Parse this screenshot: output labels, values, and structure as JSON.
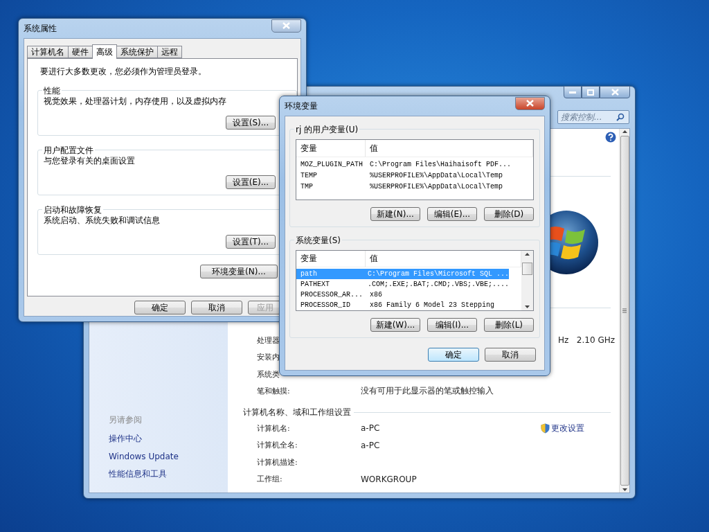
{
  "control_panel": {
    "search": {
      "placeholder": "搜索控制..."
    },
    "sidebar": {
      "heading": "另请参阅",
      "links": [
        "操作中心",
        "Windows Update",
        "性能信息和工具"
      ]
    },
    "system_rows": [
      {
        "label": "处理器",
        "value": "",
        "value_right": "Hz   2.10 GHz"
      },
      {
        "label": "安装内",
        "value": "",
        "value_right": ""
      },
      {
        "label": "系统类",
        "value": "",
        "value_right": ""
      },
      {
        "label": "笔和触摸:",
        "value": "没有可用于此显示器的笔或触控输入",
        "value_right": ""
      }
    ],
    "name_section": {
      "title": "计算机名称、域和工作组设置",
      "change_link": "更改设置",
      "rows": [
        {
          "label": "计算机名:",
          "value": "a-PC"
        },
        {
          "label": "计算机全名:",
          "value": "a-PC"
        },
        {
          "label": "计算机描述:",
          "value": ""
        },
        {
          "label": "工作组:",
          "value": "WORKGROUP"
        }
      ]
    }
  },
  "system_properties": {
    "title": "系统属性",
    "tabs": [
      {
        "label": "计算机名",
        "selected": false
      },
      {
        "label": "硬件",
        "selected": false
      },
      {
        "label": "高级",
        "selected": true
      },
      {
        "label": "系统保护",
        "selected": false
      },
      {
        "label": "远程",
        "selected": false
      }
    ],
    "notice": "要进行大多数更改，您必须作为管理员登录。",
    "groups": [
      {
        "title": "性能",
        "description": "视觉效果，处理器计划，内存使用，以及虚拟内存",
        "button": "设置(S)..."
      },
      {
        "title": "用户配置文件",
        "description": "与您登录有关的桌面设置",
        "button": "设置(E)..."
      },
      {
        "title": "启动和故障恢复",
        "description": "系统启动、系统失败和调试信息",
        "button": "设置(T)..."
      }
    ],
    "env_button": "环境变量(N)...",
    "buttons": [
      {
        "label": "确定",
        "disabled": false
      },
      {
        "label": "取消",
        "disabled": false
      },
      {
        "label": "应用",
        "disabled": true
      }
    ]
  },
  "environment_variables": {
    "title": "环境变量",
    "sections": [
      {
        "title": "rj 的用户变量(U)",
        "columns": [
          "变量",
          "值"
        ],
        "rows": [
          {
            "name": "MOZ_PLUGIN_PATH",
            "value": "C:\\Program Files\\Haihaisoft PDF...",
            "selected": false
          },
          {
            "name": "TEMP",
            "value": "%USERPROFILE%\\AppData\\Local\\Temp",
            "selected": false
          },
          {
            "name": "TMP",
            "value": "%USERPROFILE%\\AppData\\Local\\Temp",
            "selected": false
          }
        ],
        "buttons": [
          "新建(N)...",
          "编辑(E)...",
          "删除(D)"
        ]
      },
      {
        "title": "系统变量(S)",
        "columns": [
          "变量",
          "值"
        ],
        "rows": [
          {
            "name": "path",
            "value": "C:\\Program Files\\Microsoft SQL ...",
            "selected": true
          },
          {
            "name": "PATHEXT",
            "value": ".COM;.EXE;.BAT;.CMD;.VBS;.VBE;....",
            "selected": false
          },
          {
            "name": "PROCESSOR_AR...",
            "value": "x86",
            "selected": false
          },
          {
            "name": "PROCESSOR_ID",
            "value": "x86 Family 6 Model 23 Stepping",
            "selected": false
          }
        ],
        "buttons": [
          "新建(W)...",
          "编辑(I)...",
          "删除(L)"
        ]
      }
    ],
    "buttons": [
      {
        "label": "确定",
        "default": true
      },
      {
        "label": "取消",
        "default": false
      }
    ]
  }
}
